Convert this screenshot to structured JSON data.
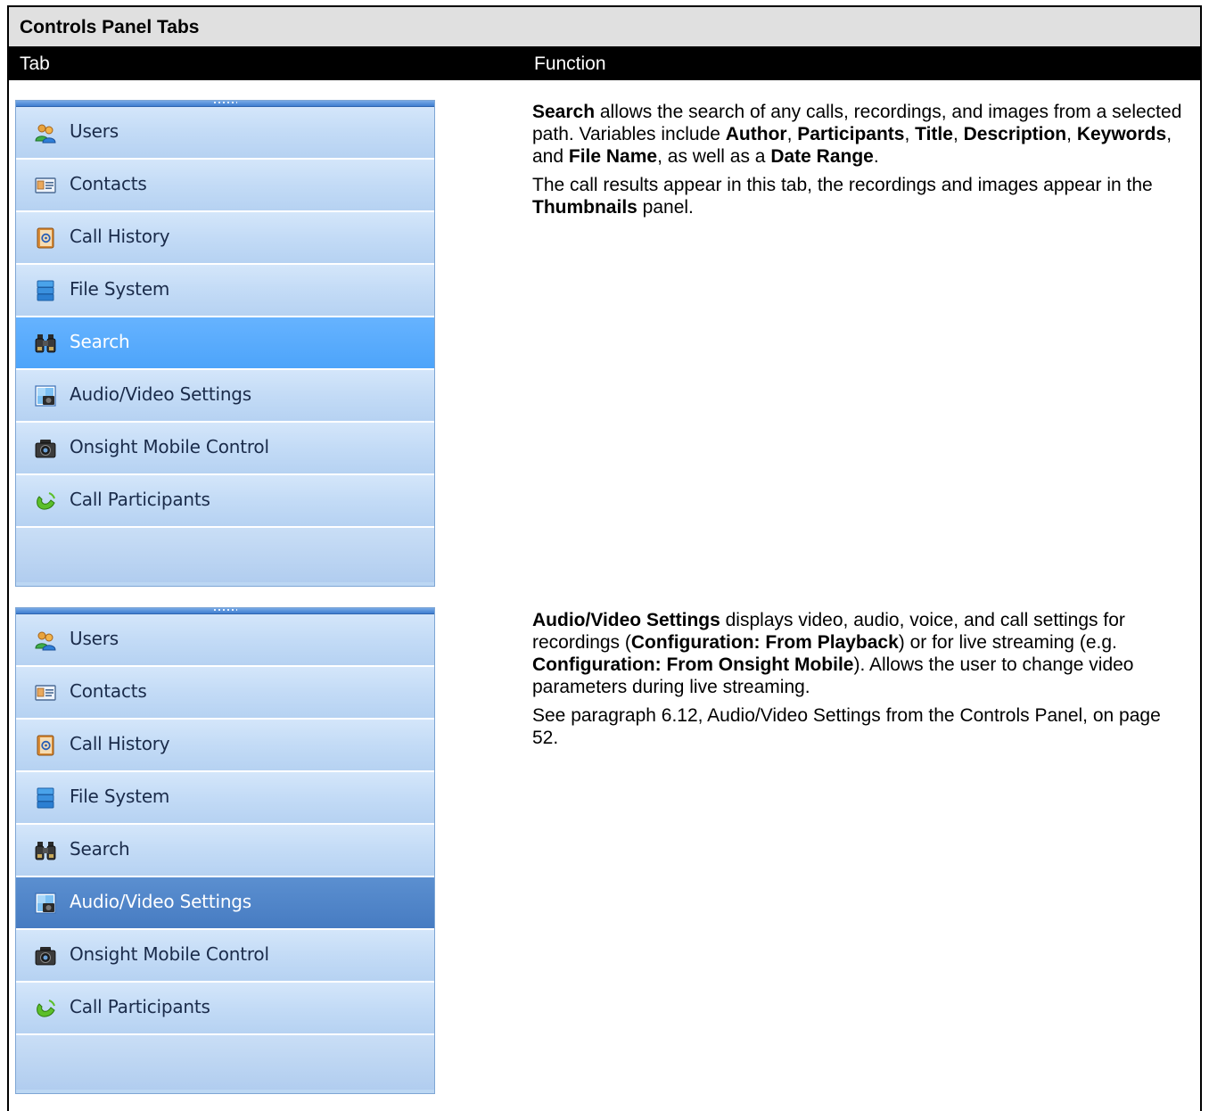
{
  "table": {
    "title": "Controls Panel Tabs",
    "col_tab": "Tab",
    "col_function": "Function"
  },
  "panel": {
    "items": [
      {
        "label": "Users",
        "icon": "users-icon"
      },
      {
        "label": "Contacts",
        "icon": "contacts-icon"
      },
      {
        "label": "Call History",
        "icon": "call-history-icon"
      },
      {
        "label": "File System",
        "icon": "file-system-icon"
      },
      {
        "label": "Search",
        "icon": "binoculars-icon"
      },
      {
        "label": "Audio/Video Settings",
        "icon": "audio-video-settings-icon"
      },
      {
        "label": "Onsight Mobile Control",
        "icon": "camera-icon"
      },
      {
        "label": "Call Participants",
        "icon": "phone-icon"
      }
    ],
    "active_color_search": "#5aaefc",
    "active_color_av": "#4d82c6"
  },
  "rows": [
    {
      "p1": [
        {
          "t": "Search",
          "b": true
        },
        {
          "t": " allows the search of any calls, recordings, and images from a selected path. Variables include "
        },
        {
          "t": "Author",
          "b": true
        },
        {
          "t": ", "
        },
        {
          "t": "Participants",
          "b": true
        },
        {
          "t": ", "
        },
        {
          "t": "Title",
          "b": true
        },
        {
          "t": ", "
        },
        {
          "t": "Description",
          "b": true
        },
        {
          "t": ", "
        },
        {
          "t": "Keywords",
          "b": true
        },
        {
          "t": ", and "
        },
        {
          "t": "File Name",
          "b": true
        },
        {
          "t": ", as well as a "
        },
        {
          "t": "Date Range",
          "b": true
        },
        {
          "t": "."
        }
      ],
      "p2": [
        {
          "t": "The call results appear in this tab, the recordings and images appear in the "
        },
        {
          "t": "Thumbnails",
          "b": true
        },
        {
          "t": " panel."
        }
      ]
    },
    {
      "p1": [
        {
          "t": "Audio/Video Settings",
          "b": true
        },
        {
          "t": " displays video, audio, voice, and call settings for recordings ("
        },
        {
          "t": "Configuration: From Playback",
          "b": true
        },
        {
          "t": ") or for live streaming (e.g. "
        },
        {
          "t": "Configuration: From Onsight Mobile",
          "b": true
        },
        {
          "t": "). Allows the user to change video parameters during live streaming."
        }
      ],
      "p2": [
        {
          "t": "See paragraph 6.12, Audio/Video Settings from the Controls Panel, on page 52."
        }
      ]
    }
  ]
}
